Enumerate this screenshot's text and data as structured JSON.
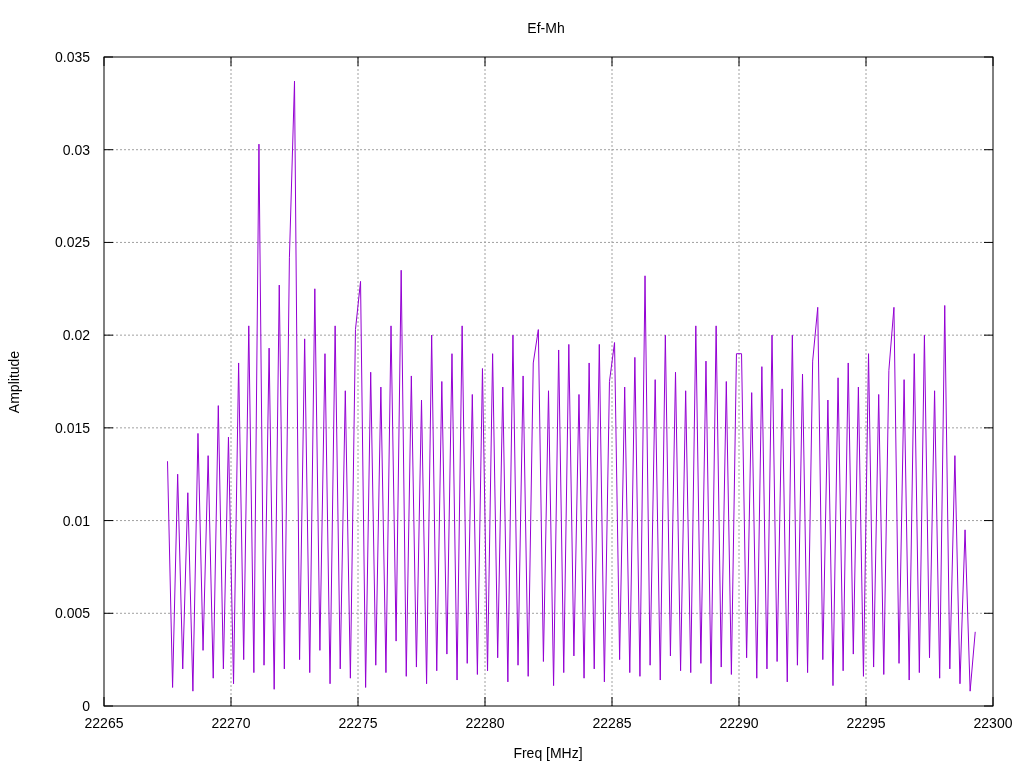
{
  "chart": {
    "chart_data": {
      "type": "line",
      "title": "Ef-Mh",
      "xlabel": "Freq [MHz]",
      "ylabel": "Amplitude",
      "xlim": [
        22265,
        22300
      ],
      "ylim": [
        0,
        0.035
      ],
      "grid": true,
      "xticks": [
        22265,
        22270,
        22275,
        22280,
        22285,
        22290,
        22295,
        22300
      ],
      "yticks": [
        0,
        0.005,
        0.01,
        0.015,
        0.02,
        0.025,
        0.03,
        0.035
      ],
      "x": [
        22267.5,
        22267.7,
        22267.9,
        22268.1,
        22268.3,
        22268.5,
        22268.7,
        22268.9,
        22269.1,
        22269.3,
        22269.5,
        22269.7,
        22269.9,
        22270.1,
        22270.3,
        22270.5,
        22270.7,
        22270.9,
        22271.1,
        22271.3,
        22271.5,
        22271.7,
        22271.9,
        22272.1,
        22272.3,
        22272.5,
        22272.7,
        22272.9,
        22273.1,
        22273.3,
        22273.5,
        22273.7,
        22273.9,
        22274.1,
        22274.3,
        22274.5,
        22274.7,
        22274.9,
        22275.1,
        22275.3,
        22275.5,
        22275.7,
        22275.9,
        22276.1,
        22276.3,
        22276.5,
        22276.7,
        22276.9,
        22277.1,
        22277.3,
        22277.5,
        22277.7,
        22277.9,
        22278.1,
        22278.3,
        22278.5,
        22278.7,
        22278.9,
        22279.1,
        22279.3,
        22279.5,
        22279.7,
        22279.9,
        22280.1,
        22280.3,
        22280.5,
        22280.7,
        22280.9,
        22281.1,
        22281.3,
        22281.5,
        22281.7,
        22281.9,
        22282.1,
        22282.3,
        22282.5,
        22282.7,
        22282.9,
        22283.1,
        22283.3,
        22283.5,
        22283.7,
        22283.9,
        22284.1,
        22284.3,
        22284.5,
        22284.7,
        22284.9,
        22285.1,
        22285.3,
        22285.5,
        22285.7,
        22285.9,
        22286.1,
        22286.3,
        22286.5,
        22286.7,
        22286.9,
        22287.1,
        22287.3,
        22287.5,
        22287.7,
        22287.9,
        22288.1,
        22288.3,
        22288.5,
        22288.7,
        22288.9,
        22289.1,
        22289.3,
        22289.5,
        22289.7,
        22289.9,
        22290.1,
        22290.3,
        22290.5,
        22290.7,
        22290.9,
        22291.1,
        22291.3,
        22291.5,
        22291.7,
        22291.9,
        22292.1,
        22292.3,
        22292.5,
        22292.7,
        22292.9,
        22293.1,
        22293.3,
        22293.5,
        22293.7,
        22293.9,
        22294.1,
        22294.3,
        22294.5,
        22294.7,
        22294.9,
        22295.1,
        22295.3,
        22295.5,
        22295.7,
        22295.9,
        22296.1,
        22296.3,
        22296.5,
        22296.7,
        22296.9,
        22297.1,
        22297.3,
        22297.5,
        22297.7,
        22297.9,
        22298.1,
        22298.3,
        22298.5,
        22298.7,
        22298.9,
        22299.1,
        22299.3
      ],
      "series": [
        {
          "color": "#9400d3",
          "values": [
            0.0132,
            0.001,
            0.0125,
            0.002,
            0.0115,
            0.0008,
            0.0147,
            0.003,
            0.0135,
            0.0015,
            0.0162,
            0.002,
            0.0145,
            0.0012,
            0.0185,
            0.0025,
            0.0205,
            0.0018,
            0.0303,
            0.0022,
            0.0193,
            0.0009,
            0.0227,
            0.002,
            0.0242,
            0.0337,
            0.0025,
            0.0198,
            0.0018,
            0.0225,
            0.003,
            0.019,
            0.0012,
            0.0205,
            0.002,
            0.017,
            0.0015,
            0.0203,
            0.0229,
            0.001,
            0.018,
            0.0022,
            0.0172,
            0.0018,
            0.0205,
            0.0035,
            0.0235,
            0.0016,
            0.0178,
            0.0021,
            0.0165,
            0.0012,
            0.02,
            0.0019,
            0.0175,
            0.0028,
            0.019,
            0.0014,
            0.0205,
            0.0023,
            0.0168,
            0.0017,
            0.0182,
            0.0019,
            0.019,
            0.0026,
            0.0172,
            0.0013,
            0.02,
            0.0022,
            0.0178,
            0.0016,
            0.0185,
            0.0203,
            0.0024,
            0.017,
            0.0011,
            0.0192,
            0.0018,
            0.0195,
            0.0027,
            0.0168,
            0.0015,
            0.0185,
            0.002,
            0.0195,
            0.0013,
            0.0175,
            0.0196,
            0.0025,
            0.0172,
            0.0018,
            0.0188,
            0.0016,
            0.0232,
            0.0022,
            0.0176,
            0.0014,
            0.02,
            0.0027,
            0.018,
            0.0019,
            0.017,
            0.0018,
            0.0205,
            0.0023,
            0.0186,
            0.0012,
            0.0205,
            0.0021,
            0.0175,
            0.0017,
            0.019,
            0.019,
            0.0026,
            0.0169,
            0.0015,
            0.0183,
            0.002,
            0.02,
            0.0024,
            0.0171,
            0.0013,
            0.02,
            0.0022,
            0.0179,
            0.0018,
            0.0186,
            0.0215,
            0.0025,
            0.0165,
            0.0011,
            0.0177,
            0.0019,
            0.0185,
            0.0028,
            0.0172,
            0.0016,
            0.019,
            0.0021,
            0.0168,
            0.0017,
            0.0181,
            0.0215,
            0.0023,
            0.0176,
            0.0014,
            0.019,
            0.0018,
            0.02,
            0.0026,
            0.017,
            0.0015,
            0.0216,
            0.002,
            0.0135,
            0.0012,
            0.0095,
            0.0008,
            0.004
          ]
        }
      ]
    }
  }
}
